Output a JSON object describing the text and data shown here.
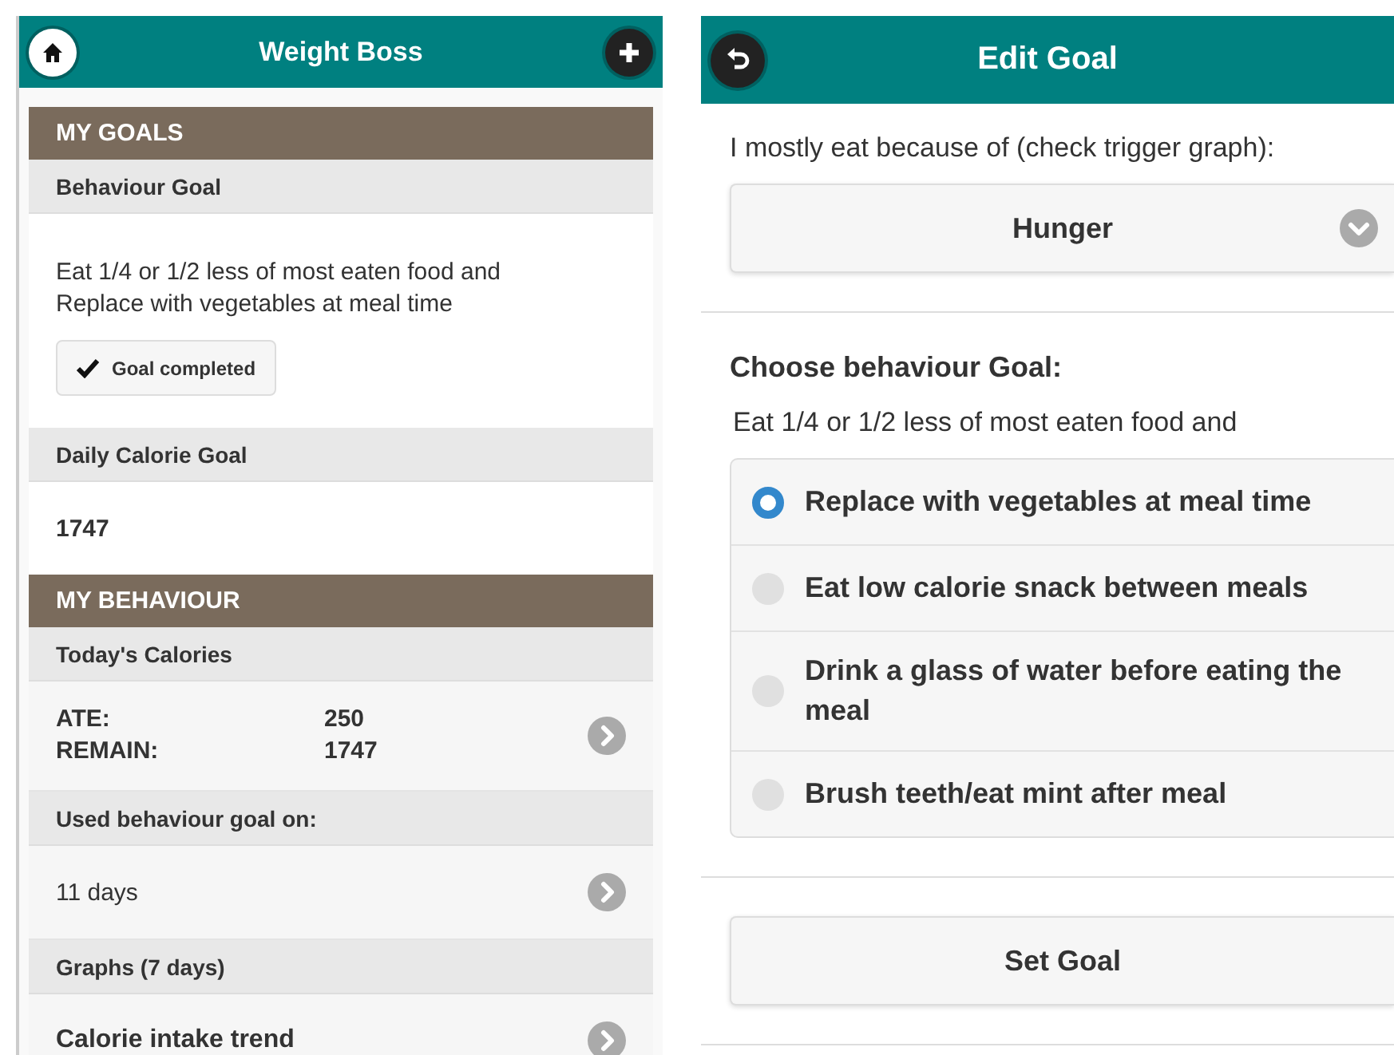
{
  "home_screen": {
    "title": "Weight Boss",
    "items": [
      {
        "kind": "section",
        "text": "MY GOALS"
      },
      {
        "kind": "subheader",
        "text": "Behaviour Goal"
      },
      {
        "kind": "goal",
        "text": "Eat 1/4 or 1/2 less of most eaten food and Replace with vegetables at meal time",
        "button": "Goal completed"
      },
      {
        "kind": "subheader",
        "text": "Daily Calorie Goal"
      },
      {
        "kind": "value",
        "text": "1747"
      },
      {
        "kind": "section",
        "text": "MY BEHAVIOUR"
      },
      {
        "kind": "subheader",
        "text": "Today's Calories"
      },
      {
        "kind": "stats",
        "rows": [
          {
            "label": "ATE:",
            "value": "250"
          },
          {
            "label": "REMAIN:",
            "value": "1747"
          }
        ]
      },
      {
        "kind": "subheader",
        "text": "Used behaviour goal on:"
      },
      {
        "kind": "link",
        "text": "11 days",
        "bold": false
      },
      {
        "kind": "subheader",
        "text": "Graphs (7 days)"
      },
      {
        "kind": "link",
        "text": "Calorie intake trend",
        "bold": true
      }
    ]
  },
  "edit_screen": {
    "title": "Edit Goal",
    "trigger_label": "I mostly eat because of (check trigger graph):",
    "trigger_select": "Hunger",
    "goal_heading": "Choose behaviour Goal:",
    "goal_intro": "Eat 1/4 or 1/2 less of most eaten food and",
    "options": [
      {
        "text": "Replace with vegetables at meal time",
        "selected": true
      },
      {
        "text": "Eat low calorie snack between meals",
        "selected": false
      },
      {
        "text": "Drink a glass of water before eating the meal",
        "selected": false
      },
      {
        "text": "Brush teeth/eat mint after meal",
        "selected": false
      }
    ],
    "button": "Set Goal"
  }
}
